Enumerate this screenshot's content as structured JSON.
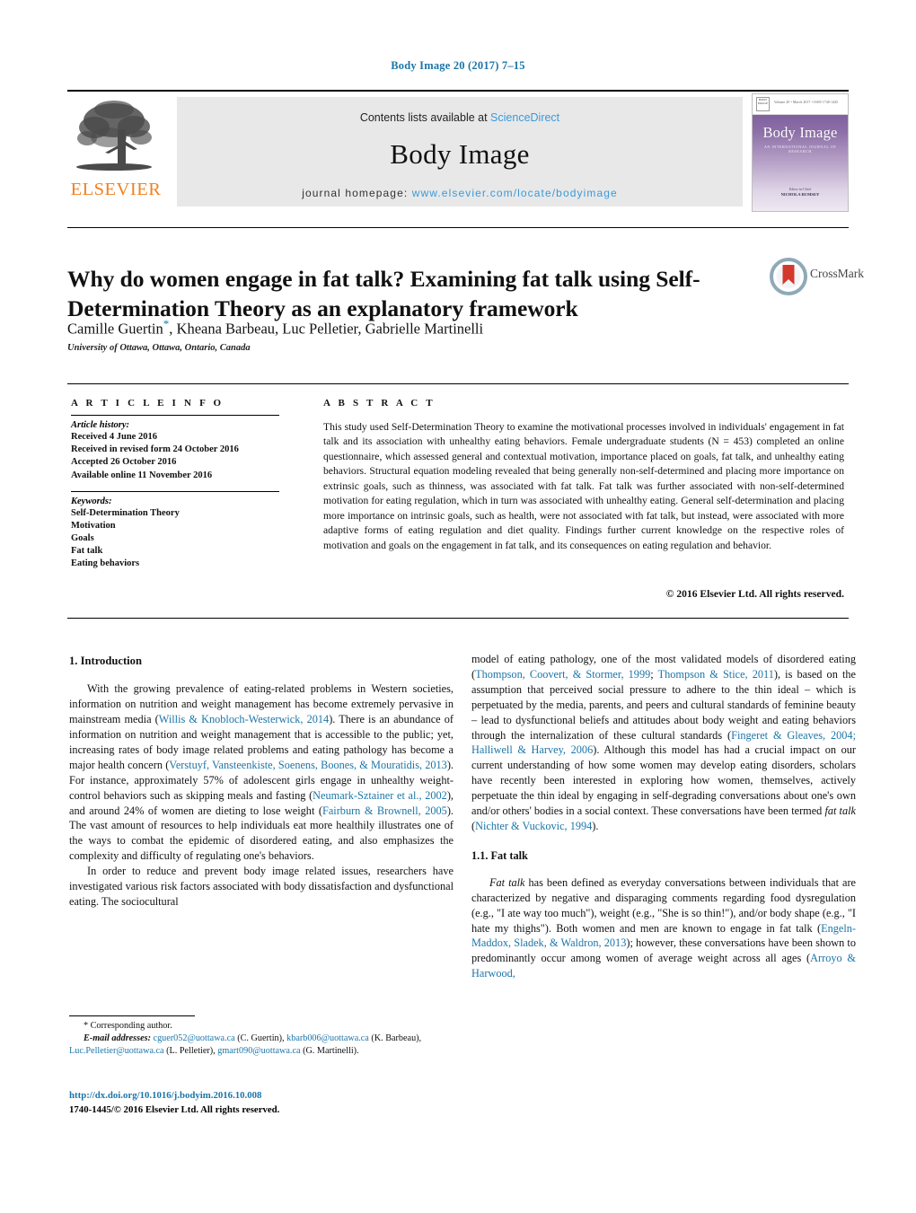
{
  "running_head": "Body Image 20 (2017) 7–15",
  "masthead": {
    "contents_prefix": "Contents lists available at ",
    "sciencedirect": "ScienceDirect",
    "journal_name": "Body Image",
    "homepage_label": "journal homepage: ",
    "homepage_url": "www.elsevier.com/locate/bodyimage",
    "publisher_wordmark": "ELSEVIER",
    "cover": {
      "badge_text": "BODY IMAGE",
      "top_line": "Volume 20 • March 2017 • ISSN 1740-1445",
      "issn": "ISSN 1740-1445",
      "title": "Body Image",
      "subtitle": "AN INTERNATIONAL JOURNAL OF RESEARCH",
      "editor_label": "Editor-in-Chief",
      "editor_name": "NICHOLA RUMSEY"
    }
  },
  "article": {
    "title": "Why do women engage in fat talk? Examining fat talk using Self-Determination Theory as an explanatory framework",
    "authors": "Camille Guertin",
    "authors_rest": ", Kheana Barbeau, Luc Pelletier, Gabrielle Martinelli",
    "corresponding_marker": "*",
    "affiliation": "University of Ottawa, Ottawa, Ontario, Canada",
    "crossmark_label": "CrossMark"
  },
  "info": {
    "heading": "A R T I C L E   I N F O",
    "history_label": "Article history:",
    "history": [
      "Received 4 June 2016",
      "Received in revised form 24 October 2016",
      "Accepted 26 October 2016",
      "Available online 11 November 2016"
    ],
    "keywords_label": "Keywords:",
    "keywords": [
      "Self-Determination Theory",
      "Motivation",
      "Goals",
      "Fat talk",
      "Eating behaviors"
    ]
  },
  "abstract": {
    "heading": "A B S T R A C T",
    "text": "This study used Self-Determination Theory to examine the motivational processes involved in individuals' engagement in fat talk and its association with unhealthy eating behaviors. Female undergraduate students (N = 453) completed an online questionnaire, which assessed general and contextual motivation, importance placed on goals, fat talk, and unhealthy eating behaviors. Structural equation modeling revealed that being generally non-self-determined and placing more importance on extrinsic goals, such as thinness, was associated with fat talk. Fat talk was further associated with non-self-determined motivation for eating regulation, which in turn was associated with unhealthy eating. General self-determination and placing more importance on intrinsic goals, such as health, were not associated with fat talk, but instead, were associated with more adaptive forms of eating regulation and diet quality. Findings further current knowledge on the respective roles of motivation and goals on the engagement in fat talk, and its consequences on eating regulation and behavior.",
    "copyright": "© 2016 Elsevier Ltd. All rights reserved."
  },
  "body": {
    "section1_heading": "1.  Introduction",
    "left_p1_a": "With the growing prevalence of eating-related problems in Western societies, information on nutrition and weight management has become extremely pervasive in mainstream media (",
    "left_p1_ref1": "Willis & Knobloch-Westerwick, 2014",
    "left_p1_b": "). There is an abundance of information on nutrition and weight management that is accessible to the public; yet, increasing rates of body image related problems and eating pathology has become a major health concern (",
    "left_p1_ref2": "Verstuyf, Vansteenkiste, Soenens, Boones, & Mouratidis, 2013",
    "left_p1_c": "). For instance, approximately 57% of adolescent girls engage in unhealthy weight-control behaviors such as skipping meals and fasting (",
    "left_p1_ref3": "Neumark-Sztainer et al., 2002",
    "left_p1_d": "), and around 24% of women are dieting to lose weight (",
    "left_p1_ref4": "Fairburn & Brownell, 2005",
    "left_p1_e": "). The vast amount of resources to help individuals eat more healthily illustrates one of the ways to combat the epidemic of disordered eating, and also emphasizes the complexity and difficulty of regulating one's behaviors.",
    "left_p2": "In order to reduce and prevent body image related issues, researchers have investigated various risk factors associated with body dissatisfaction and dysfunctional eating. The sociocultural",
    "right_p1_a": "model of eating pathology, one of the most validated models of disordered eating (",
    "right_p1_ref1": "Thompson, Coovert, & Stormer, 1999",
    "right_p1_semi": "; ",
    "right_p1_ref2": "Thompson & Stice, 2011",
    "right_p1_b": "), is based on the assumption that perceived social pressure to adhere to the thin ideal – which is perpetuated by the media, parents, and peers and cultural standards of feminine beauty – lead to dysfunctional beliefs and attitudes about body weight and eating behaviors through the internalization of these cultural standards (",
    "right_p1_ref3": "Fingeret & Gleaves, 2004; Halliwell & Harvey, 2006",
    "right_p1_c": "). Although this model has had a crucial impact on our current understanding of how some women may develop eating disorders, scholars have recently been interested in exploring how women, themselves, actively perpetuate the thin ideal by engaging in self-degrading conversations about one's own and/or others' bodies in a social context. These conversations have been termed ",
    "right_p1_italic": "fat talk",
    "right_p1_d": " (",
    "right_p1_ref4": "Nichter & Vuckovic, 1994",
    "right_p1_e": ").",
    "subsection_heading": "1.1.  Fat talk",
    "right_p2_italic": "Fat talk",
    "right_p2_a": " has been defined as everyday conversations between individuals that are characterized by negative and disparaging comments regarding food dysregulation (e.g., \"I ate way too much\"), weight (e.g., \"She is so thin!\"), and/or body shape (e.g., \"I hate my thighs\"). Both women and men are known to engage in fat talk (",
    "right_p2_ref1": "Engeln-Maddox, Sladek, & Waldron, 2013",
    "right_p2_b": "); however, these conversations have been shown to predominantly occur among women of average weight across all ages (",
    "right_p2_ref2": "Arroyo & Harwood,"
  },
  "footnotes": {
    "corresponding": "* Corresponding author.",
    "email_label": "E-mail addresses:",
    "email1": "cguer052@uottawa.ca",
    "email1_who": " (C. Guertin), ",
    "email2": "kbarb006@uottawa.ca",
    "email2_who": " (K. Barbeau), ",
    "email3": "Luc.Pelletier@uottawa.ca",
    "email3_who": " (L. Pelletier), ",
    "email4": "gmart090@uottawa.ca",
    "email4_who": " (G. Martinelli).",
    "doi": "http://dx.doi.org/10.1016/j.bodyim.2016.10.008",
    "issn_line": "1740-1445/© 2016 Elsevier Ltd. All rights reserved."
  },
  "colors": {
    "link": "#1b75a8",
    "sciencedirect": "#3a9ad9",
    "elsevier_orange": "#f08121",
    "crossmark_red": "#d3382c"
  }
}
